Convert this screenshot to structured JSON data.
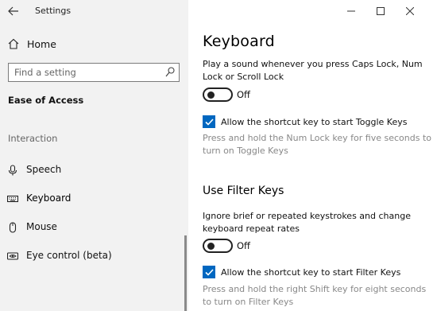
{
  "window": {
    "title": "Settings"
  },
  "sidebar": {
    "home_label": "Home",
    "search_placeholder": "Find a setting",
    "category": "Ease of Access",
    "section": "Interaction",
    "items": [
      {
        "label": "Speech",
        "icon": "microphone-icon"
      },
      {
        "label": "Keyboard",
        "icon": "keyboard-icon",
        "selected": true
      },
      {
        "label": "Mouse",
        "icon": "mouse-icon"
      },
      {
        "label": "Eye control (beta)",
        "icon": "eye-control-icon"
      }
    ]
  },
  "main": {
    "page_title": "Keyboard",
    "toggle_keys": {
      "description": "Play a sound whenever you press Caps Lock, Num Lock or Scroll Lock",
      "toggle_state": "Off",
      "shortcut_label": "Allow the shortcut key to start Toggle Keys",
      "shortcut_checked": true,
      "shortcut_help": "Press and hold the Num Lock key for five seconds to turn on Toggle Keys"
    },
    "filter_keys": {
      "heading": "Use Filter Keys",
      "description": "Ignore brief or repeated keystrokes and change keyboard repeat rates",
      "toggle_state": "Off",
      "shortcut_label": "Allow the shortcut key to start Filter Keys",
      "shortcut_checked": true,
      "shortcut_help": "Press and hold the right Shift key for eight seconds to turn on Filter Keys"
    }
  },
  "colors": {
    "accent": "#0067c0",
    "sidebar_bg": "#f2f2f2"
  }
}
